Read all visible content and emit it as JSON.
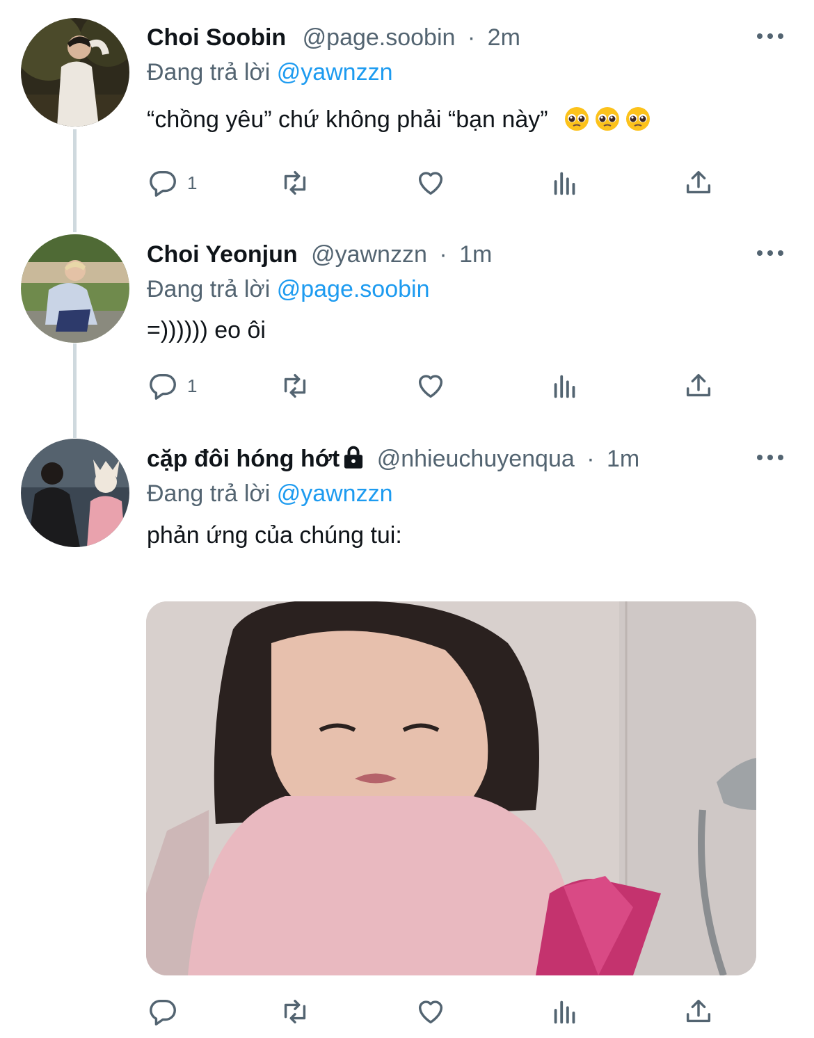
{
  "tweets": [
    {
      "name": "Choi Soobin",
      "handle": "@page.soobin",
      "dot": "·",
      "time": "2m",
      "replying_prefix": "Đang trả lời ",
      "replying_to": "@yawnzzn",
      "text": "“chồng yêu” chứ không phải “bạn này”",
      "emoji": [
        "pleading-face",
        "pleading-face",
        "pleading-face"
      ],
      "reply_count": "1"
    },
    {
      "name": "Choi Yeonjun",
      "handle": "@yawnzzn",
      "dot": "·",
      "time": "1m",
      "replying_prefix": "Đang trả lời ",
      "replying_to": "@page.soobin",
      "text": "=)))))) eo ôi",
      "reply_count": "1"
    },
    {
      "name": "cặp đôi hóng hớt",
      "handle": "@nhieuchuyenqua",
      "dot": "·",
      "time": "1m",
      "replying_prefix": "Đang trả lời ",
      "replying_to": "@yawnzzn",
      "text": "phản ứng của chúng tui:",
      "protected": true,
      "media": "photo of a girl with a bob haircut frowning at a pink phone"
    }
  ],
  "icons": {
    "reply": "reply-icon",
    "retweet": "retweet-icon",
    "like": "like-icon",
    "views": "views-icon",
    "share": "share-icon",
    "more": "more-icon",
    "lock": "lock-icon"
  },
  "colors": {
    "text": "#0f1419",
    "secondary": "#536471",
    "accent": "#1d9bf0",
    "thread_line": "#cfd9de"
  }
}
